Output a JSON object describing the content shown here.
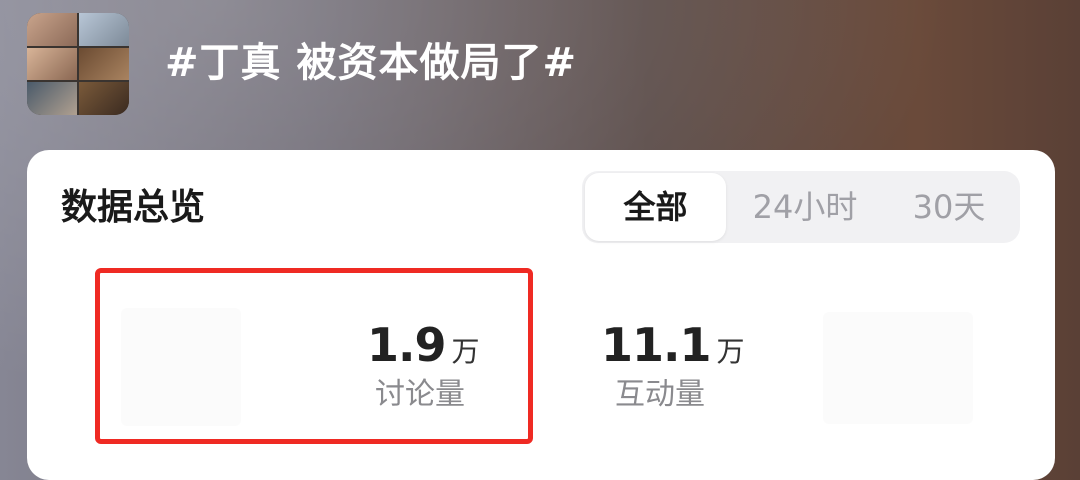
{
  "topic": {
    "title": "#丁真 被资本做局了#",
    "thumbnail_icon": "topic-collage-image"
  },
  "overview": {
    "title": "数据总览",
    "tabs": [
      {
        "label": "全部",
        "active": true
      },
      {
        "label": "24小时",
        "active": false
      },
      {
        "label": "30天",
        "active": false
      }
    ],
    "stats": [
      {
        "value": "1.9",
        "unit": "万",
        "label": "讨论量"
      },
      {
        "value": "11.1",
        "unit": "万",
        "label": "互动量"
      }
    ]
  },
  "colors": {
    "highlight": "#ef2a23",
    "card_bg": "#ffffff",
    "segment_bg": "#f1f1f3"
  }
}
